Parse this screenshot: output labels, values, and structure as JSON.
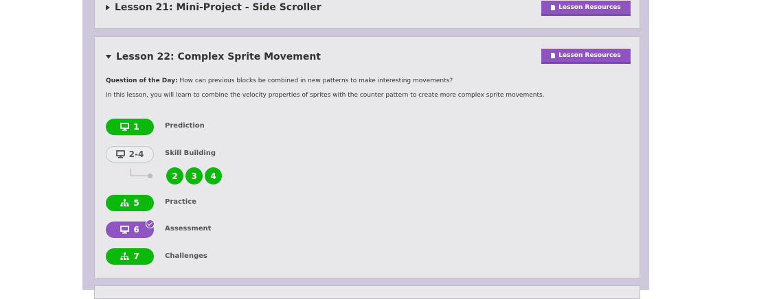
{
  "lesson21": {
    "title": "Lesson 21: Mini-Project - Side Scroller",
    "resources_label": "Lesson Resources"
  },
  "lesson22": {
    "title": "Lesson 22: Complex Sprite Movement",
    "resources_label": "Lesson Resources",
    "qotd_label": "Question of the Day:",
    "qotd_text": " How can previous blocks be combined in new patterns to make interesting movements?",
    "description": "In this lesson, you will learn to combine the velocity properties of sprites with the counter pattern to create more complex sprite movements.",
    "levels": [
      {
        "num": "1",
        "label": "Prediction",
        "icon": "monitor-icon",
        "style": "green"
      },
      {
        "num": "2-4",
        "label": "Skill Building",
        "icon": "monitor-icon",
        "style": "outline"
      },
      {
        "num": "5",
        "label": "Practice",
        "icon": "hierarchy-icon",
        "style": "green"
      },
      {
        "num": "6",
        "label": "Assessment",
        "icon": "monitor-icon",
        "style": "purple"
      },
      {
        "num": "7",
        "label": "Challenges",
        "icon": "hierarchy-icon",
        "style": "green"
      }
    ],
    "sublevels": [
      "2",
      "3",
      "4"
    ]
  },
  "colors": {
    "green": "#0db80d",
    "purple": "#8e55c2",
    "background": "#cfc8dd",
    "card": "#e8e8ea"
  }
}
